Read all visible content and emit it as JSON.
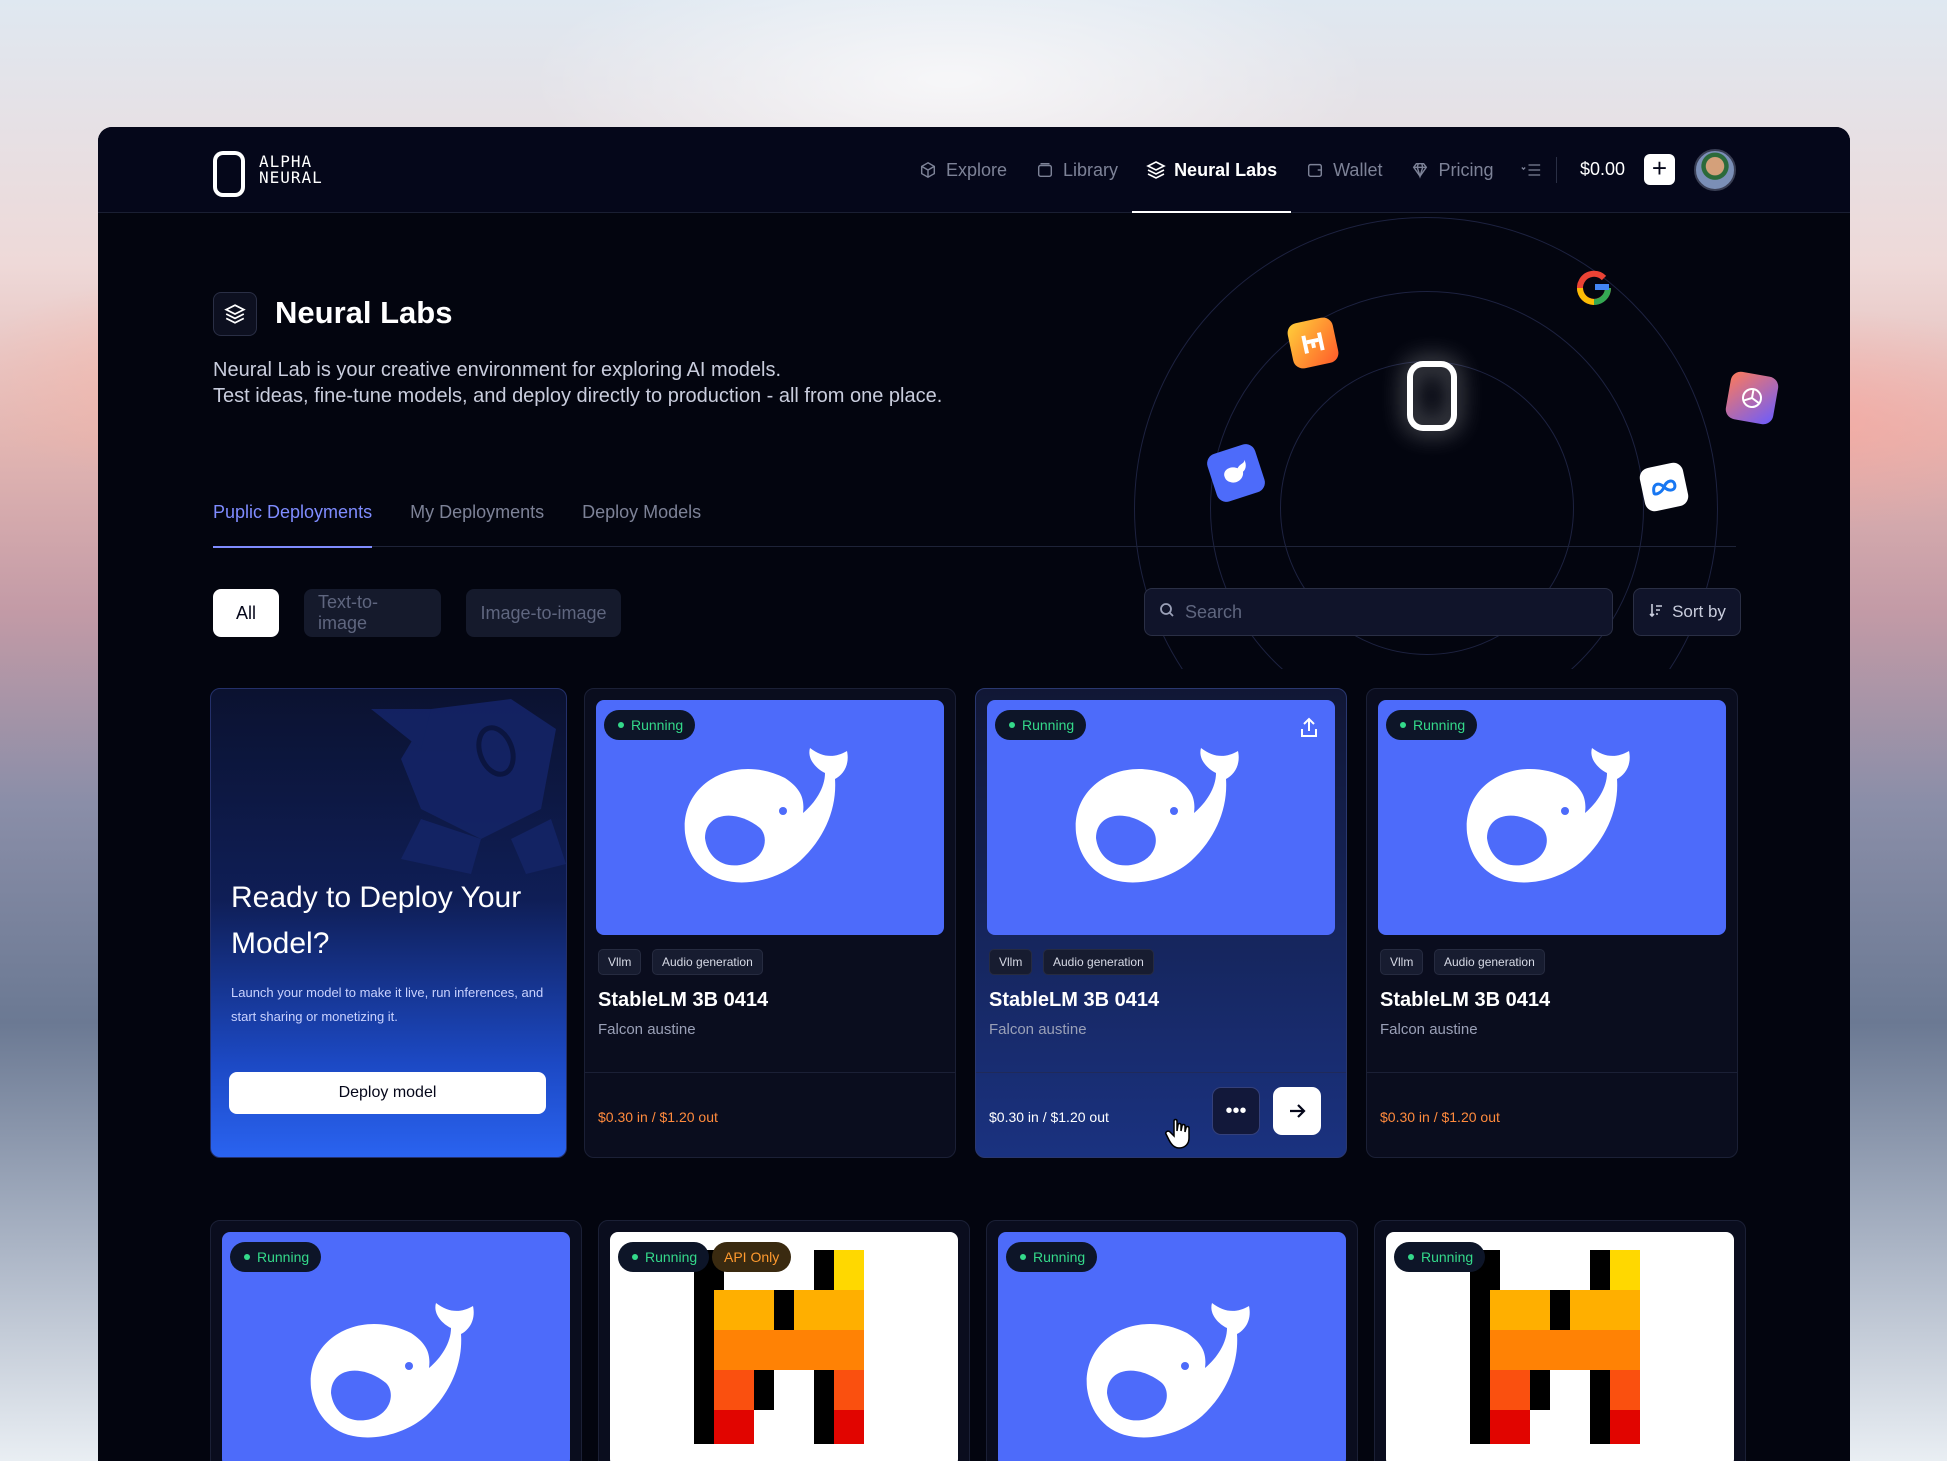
{
  "brand": {
    "line1": "ALPHA",
    "line2": "NEURAL"
  },
  "nav": {
    "items": [
      {
        "label": "Explore",
        "icon": "cube-icon"
      },
      {
        "label": "Library",
        "icon": "library-icon"
      },
      {
        "label": "Neural Labs",
        "icon": "layers-icon",
        "active": true
      },
      {
        "label": "Wallet",
        "icon": "wallet-icon"
      },
      {
        "label": "Pricing",
        "icon": "diamond-icon"
      }
    ],
    "menu_icon": "menu-icon",
    "balance": "$0.00"
  },
  "hero": {
    "title": "Neural Labs",
    "desc_line1": "Neural Lab is your creative environment for exploring AI models.",
    "desc_line2": "Test ideas, fine-tune models, and deploy directly to production - all from one place."
  },
  "tabs": [
    "Puplic Deployments",
    "My Deployments",
    "Deploy Models"
  ],
  "filters": [
    "All",
    "Text-to-image",
    "Image-to-image"
  ],
  "search": {
    "placeholder": "Search"
  },
  "sort_label": "Sort by",
  "deploy_card": {
    "title": "Ready to Deploy Your Model?",
    "desc": "Launch your model to make it live, run inferences, and start sharing or monetizing it.",
    "button": "Deploy model"
  },
  "cards": [
    {
      "status": "Running",
      "tags": [
        "Vllm",
        "Audio generation"
      ],
      "title": "StableLM 3B 0414",
      "author": "Falcon austine",
      "price": "$0.30 in / $1.20 out"
    },
    {
      "status": "Running",
      "tags": [
        "Vllm",
        "Audio generation"
      ],
      "title": "StableLM 3B 0414",
      "author": "Falcon austine",
      "price": "$0.30 in / $1.20 out"
    },
    {
      "status": "Running",
      "tags": [
        "Vllm",
        "Audio generation"
      ],
      "title": "StableLM 3B 0414",
      "author": "Falcon austine",
      "price": "$0.30 in / $1.20 out"
    }
  ],
  "bottom_cards": [
    {
      "status": "Running"
    },
    {
      "status": "Running",
      "extra": "API Only"
    },
    {
      "status": "Running"
    },
    {
      "status": "Running"
    }
  ],
  "colors": {
    "accent": "#7f8cff",
    "running": "#34d98a",
    "price": "#ff8a3d",
    "thumb_blue": "#4d6bfa"
  }
}
